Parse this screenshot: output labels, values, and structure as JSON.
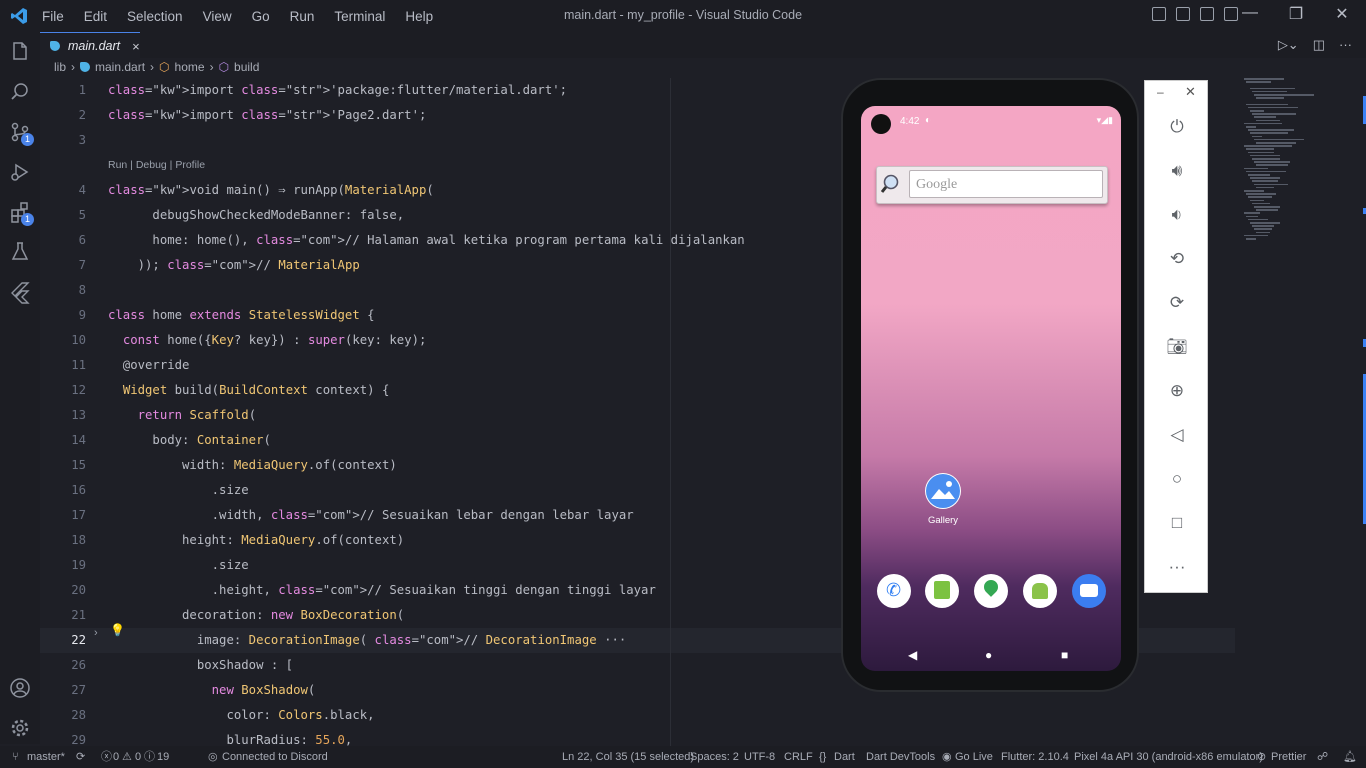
{
  "window": {
    "title": "main.dart - my_profile - Visual Studio Code",
    "menu": [
      "File",
      "Edit",
      "Selection",
      "View",
      "Go",
      "Run",
      "Terminal",
      "Help"
    ]
  },
  "activity_bar": {
    "items": [
      {
        "name": "explorer",
        "icon": "files-icon"
      },
      {
        "name": "search",
        "icon": "search-icon"
      },
      {
        "name": "source-control",
        "icon": "source-control-icon",
        "badge": "1"
      },
      {
        "name": "run-debug",
        "icon": "run-debug-icon"
      },
      {
        "name": "extensions",
        "icon": "extensions-icon",
        "badge": "1"
      },
      {
        "name": "testing",
        "icon": "flask-icon"
      },
      {
        "name": "flutter",
        "icon": "flutter-icon"
      },
      {
        "name": "accounts",
        "icon": "account-icon"
      },
      {
        "name": "manage",
        "icon": "gear-icon"
      }
    ]
  },
  "tab": {
    "label": "main.dart",
    "close": "×"
  },
  "breadcrumb": [
    "lib",
    "main.dart",
    "home",
    "build"
  ],
  "codelens": "Run | Debug | Profile",
  "code": {
    "lines": [
      {
        "n": "1",
        "t": "import 'package:flutter/material.dart';"
      },
      {
        "n": "2",
        "t": "import 'Page2.dart';"
      },
      {
        "n": "3",
        "t": ""
      },
      {
        "n": "4",
        "t": "void main() ⇒ runApp(MaterialApp("
      },
      {
        "n": "5",
        "t": "      debugShowCheckedModeBanner: false,"
      },
      {
        "n": "6",
        "t": "      home: home(), // Halaman awal ketika program pertama kali dijalankan"
      },
      {
        "n": "7",
        "t": "    )); // MaterialApp"
      },
      {
        "n": "8",
        "t": ""
      },
      {
        "n": "9",
        "t": "class home extends StatelessWidget {"
      },
      {
        "n": "10",
        "t": "  const home({Key? key}) : super(key: key);"
      },
      {
        "n": "11",
        "t": "  @override"
      },
      {
        "n": "12",
        "t": "  Widget build(BuildContext context) {"
      },
      {
        "n": "13",
        "t": "    return Scaffold("
      },
      {
        "n": "14",
        "t": "      body: Container("
      },
      {
        "n": "15",
        "t": "          width: MediaQuery.of(context)"
      },
      {
        "n": "16",
        "t": "              .size"
      },
      {
        "n": "17",
        "t": "              .width, // Sesuaikan lebar dengan lebar layar"
      },
      {
        "n": "18",
        "t": "          height: MediaQuery.of(context)"
      },
      {
        "n": "19",
        "t": "              .size"
      },
      {
        "n": "20",
        "t": "              .height, // Sesuaikan tinggi dengan tinggi layar"
      },
      {
        "n": "21",
        "t": "          decoration: new BoxDecoration("
      },
      {
        "n": "22",
        "t": "            image: DecorationImage( // DecorationImage ···"
      },
      {
        "n": "26",
        "t": "            boxShadow : ["
      },
      {
        "n": "27",
        "t": "              new BoxShadow("
      },
      {
        "n": "28",
        "t": "                color: Colors.black,"
      },
      {
        "n": "29",
        "t": "                blurRadius: 55.0,"
      }
    ]
  },
  "emulator": {
    "time": "4:42",
    "search_placeholder": "Google",
    "gallery_label": "Gallery",
    "controls": [
      "power-icon",
      "volume-up-icon",
      "volume-down-icon",
      "rotate-left-icon",
      "rotate-right-icon",
      "camera-icon",
      "zoom-icon",
      "back-icon",
      "home-icon",
      "overview-icon",
      "more-icon"
    ]
  },
  "statusbar": {
    "branch": "master*",
    "problems": "0",
    "warnings": "0",
    "infos": "19",
    "discord": "Connected to Discord",
    "position": "Ln 22, Col 35 (15 selected)",
    "spaces": "Spaces: 2",
    "encoding": "UTF-8",
    "eol": "CRLF",
    "language": "Dart",
    "devtools": "Dart DevTools",
    "golive": "Go Live",
    "flutter": "Flutter: 2.10.4",
    "device": "Pixel 4a API 30 (android-x86 emulator)",
    "prettier": "Prettier"
  },
  "colors": {
    "accent": "#4a83e8",
    "background": "#1e1f26"
  }
}
